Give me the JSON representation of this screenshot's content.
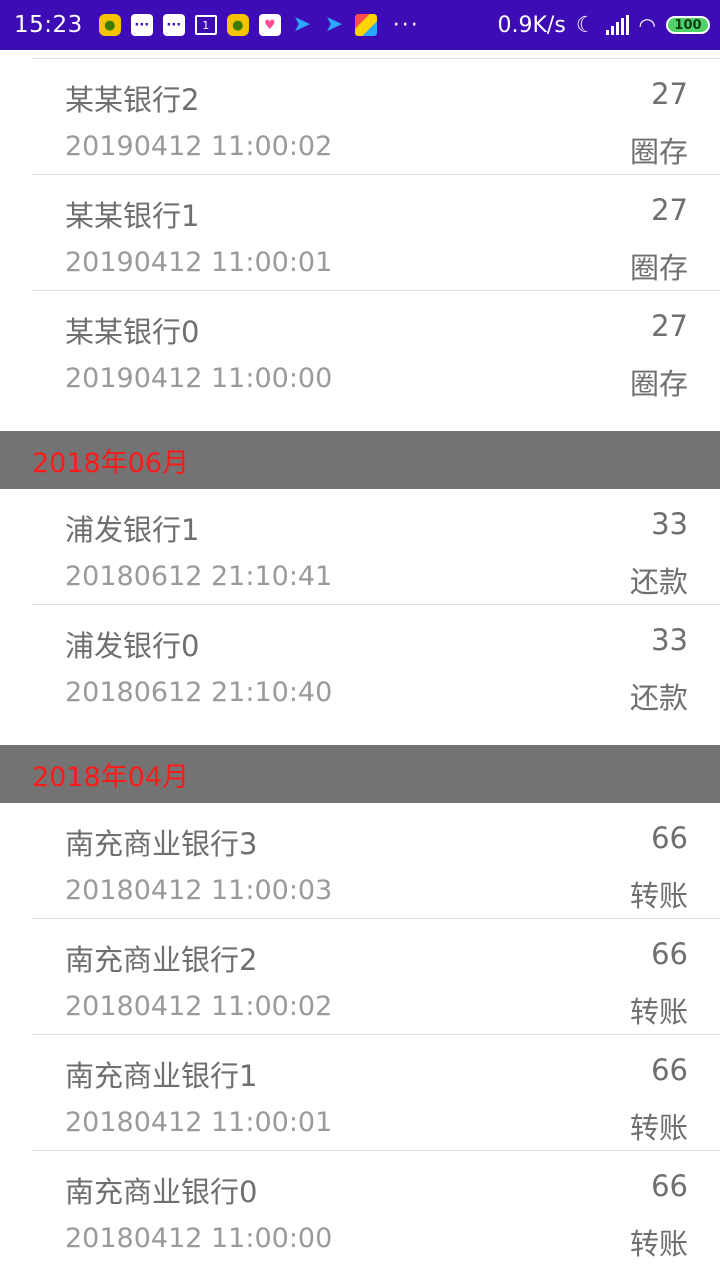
{
  "status_bar": {
    "time": "15:23",
    "net_speed": "0.9K/s",
    "battery": "100",
    "calendar_day": "1",
    "more": "···"
  },
  "groups": [
    {
      "header": "",
      "rows": [
        {
          "name": "某某银行2",
          "amount": "27",
          "time": "20190412 11:00:02",
          "type": "圈存"
        },
        {
          "name": "某某银行1",
          "amount": "27",
          "time": "20190412 11:00:01",
          "type": "圈存"
        },
        {
          "name": "某某银行0",
          "amount": "27",
          "time": "20190412 11:00:00",
          "type": "圈存"
        }
      ]
    },
    {
      "header": "2018年06月",
      "rows": [
        {
          "name": "浦发银行1",
          "amount": "33",
          "time": "20180612 21:10:41",
          "type": "还款"
        },
        {
          "name": "浦发银行0",
          "amount": "33",
          "time": "20180612 21:10:40",
          "type": "还款"
        }
      ]
    },
    {
      "header": "2018年04月",
      "rows": [
        {
          "name": "南充商业银行3",
          "amount": "66",
          "time": "20180412 11:00:03",
          "type": "转账"
        },
        {
          "name": "南充商业银行2",
          "amount": "66",
          "time": "20180412 11:00:02",
          "type": "转账"
        },
        {
          "name": "南充商业银行1",
          "amount": "66",
          "time": "20180412 11:00:01",
          "type": "转账"
        },
        {
          "name": "南充商业银行0",
          "amount": "66",
          "time": "20180412 11:00:00",
          "type": "转账"
        }
      ]
    }
  ],
  "colors": {
    "status_bar_bg": "#3d0cb5",
    "section_header_bg": "#737373",
    "section_header_text": "#ff1a1a"
  }
}
